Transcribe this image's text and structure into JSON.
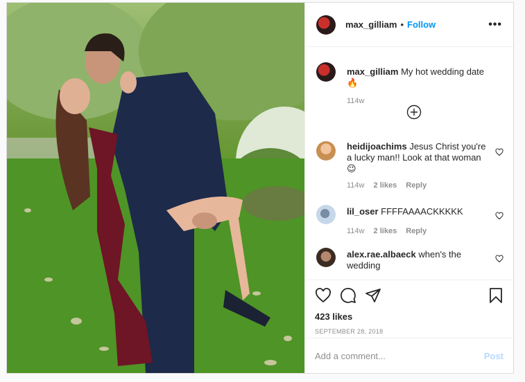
{
  "header": {
    "username": "max_gilliam",
    "separator": "•",
    "follow_label": "Follow",
    "more_label": "•••"
  },
  "caption": {
    "username": "max_gilliam",
    "text": "My hot wedding date🔥",
    "age": "114w"
  },
  "comments": [
    {
      "username": "heidijoachims",
      "text": "Jesus Christ you're a lucky man!! Look at that woman 😉",
      "age": "114w",
      "likes": "2 likes",
      "reply": "Reply"
    },
    {
      "username": "lil_oser",
      "text": "FFFFAAAACKKKKK",
      "age": "114w",
      "likes": "2 likes",
      "reply": "Reply"
    },
    {
      "username": "alex.rae.albaeck",
      "text": "when's the wedding"
    }
  ],
  "actions": {
    "likes": "423 likes",
    "date": "SEPTEMBER 28, 2018"
  },
  "add_comment": {
    "placeholder": "Add a comment...",
    "post_label": "Post"
  },
  "colors": {
    "accent": "#0095f6",
    "muted": "#8e8e8e",
    "post_disabled": "#b3dbff"
  },
  "icons": [
    "more-icon",
    "add-circle-icon",
    "heart-icon",
    "comment-icon",
    "share-icon",
    "bookmark-icon"
  ]
}
